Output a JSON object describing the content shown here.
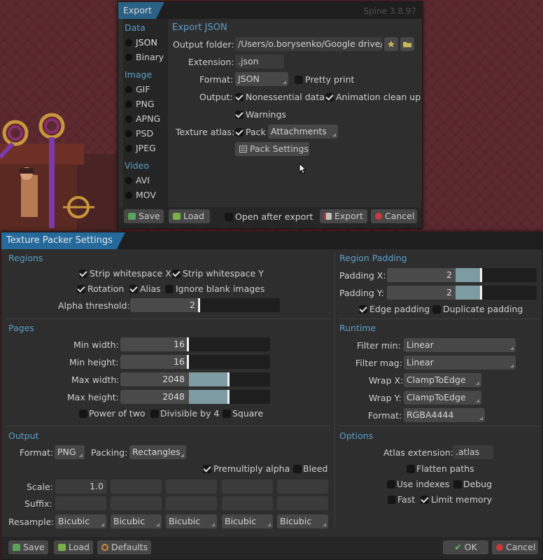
{
  "export_window": {
    "title": "Export",
    "version": "Spine 3.8.97",
    "sidebar": {
      "data_header": "Data",
      "json": "JSON",
      "binary": "Binary",
      "image_header": "Image",
      "gif": "GIF",
      "png": "PNG",
      "apng": "APNG",
      "psd": "PSD",
      "jpeg": "JPEG",
      "video_header": "Video",
      "avi": "AVI",
      "mov": "MOV"
    },
    "heading": "Export JSON",
    "output_folder_label": "Output folder:",
    "output_folder_value": "/Users/o.borysenko/Google drive/",
    "extension_label": "Extension:",
    "extension_value": ".json",
    "format_label": "Format:",
    "format_value": "JSON",
    "pretty_print": "Pretty print",
    "output_label": "Output:",
    "nonessential": "Nonessential data",
    "animation_cleanup": "Animation clean up",
    "warnings": "Warnings",
    "texture_atlas_label": "Texture atlas:",
    "pack": "Pack",
    "pack_source": "Attachments",
    "pack_settings": "Pack Settings",
    "save": "Save",
    "load": "Load",
    "open_after_export": "Open after export",
    "export": "Export",
    "cancel": "Cancel"
  },
  "packer": {
    "title": "Texture Packer Settings",
    "regions": {
      "header": "Regions",
      "strip_x": "Strip whitespace X",
      "strip_y": "Strip whitespace Y",
      "rotation": "Rotation",
      "alias": "Alias",
      "ignore_blank": "Ignore blank images",
      "alpha_label": "Alpha threshold:",
      "alpha_value": "2",
      "alpha_fraction": 0.0
    },
    "pages": {
      "header": "Pages",
      "min_width_label": "Min width:",
      "min_width": "16",
      "min_height_label": "Min height:",
      "min_height": "16",
      "max_width_label": "Max width:",
      "max_width": "2048",
      "max_height_label": "Max height:",
      "max_height": "2048",
      "pot": "Power of two",
      "div4": "Divisible by 4",
      "square": "Square"
    },
    "output": {
      "header": "Output",
      "format_label": "Format:",
      "format_value": "PNG",
      "packing_label": "Packing:",
      "packing_value": "Rectangles",
      "premultiply": "Premultiply alpha",
      "bleed": "Bleed",
      "scale_label": "Scale:",
      "scale_value": "1.0",
      "suffix_label": "Suffix:",
      "resample_label": "Resample:",
      "resample": [
        "Bicubic",
        "Bicubic",
        "Bicubic",
        "Bicubic",
        "Bicubic"
      ]
    },
    "padding": {
      "header": "Region Padding",
      "px_label": "Padding X:",
      "px": "2",
      "py_label": "Padding Y:",
      "py": "2",
      "edge": "Edge padding",
      "duplicate": "Duplicate padding"
    },
    "runtime": {
      "header": "Runtime",
      "filter_min_label": "Filter min:",
      "filter_min": "Linear",
      "filter_mag_label": "Filter mag:",
      "filter_mag": "Linear",
      "wrap_x_label": "Wrap X:",
      "wrap_x": "ClampToEdge",
      "wrap_y_label": "Wrap Y:",
      "wrap_y": "ClampToEdge",
      "format_label": "Format:",
      "format": "RGBA4444"
    },
    "options": {
      "header": "Options",
      "atlas_ext_label": "Atlas extension:",
      "atlas_ext": ".atlas",
      "flatten": "Flatten paths",
      "use_indexes": "Use indexes",
      "debug": "Debug",
      "fast": "Fast",
      "limit_memory": "Limit memory"
    },
    "buttons": {
      "save": "Save",
      "load": "Load",
      "defaults": "Defaults",
      "ok": "OK",
      "cancel": "Cancel"
    }
  },
  "colors": {
    "accent": "#2a6185",
    "section": "#5b9fc7",
    "slider_fill": "#7d9ba2"
  }
}
